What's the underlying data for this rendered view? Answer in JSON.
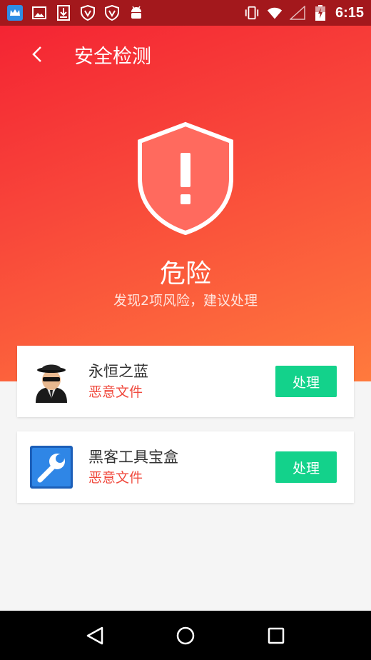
{
  "statusbar": {
    "time": "6:15",
    "left_icons": [
      "crown-app-icon",
      "image-icon",
      "download-icon",
      "shield-v-icon",
      "shield-v-icon",
      "android-icon"
    ],
    "right_icons": [
      "vibrate-icon",
      "wifi-icon",
      "signal-icon",
      "battery-icon"
    ]
  },
  "appbar": {
    "title": "安全检测"
  },
  "status": {
    "title": "危险",
    "subtitle": "发现2项风险，建议处理"
  },
  "threats": [
    {
      "name": "永恒之蓝",
      "type": "恶意文件",
      "action": "处理",
      "icon": "hacker-avatar-icon"
    },
    {
      "name": "黑客工具宝盒",
      "type": "恶意文件",
      "action": "处理",
      "icon": "wrench-app-icon"
    }
  ],
  "colors": {
    "accent": "#13d28b",
    "danger_text": "#f04a3e",
    "hero_top": "#f42433",
    "hero_bottom": "#ff7a3d",
    "statusbar": "#a3181c"
  }
}
